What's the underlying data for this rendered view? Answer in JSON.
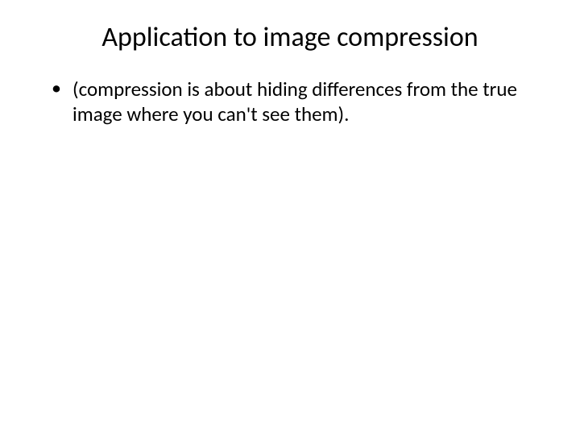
{
  "slide": {
    "title": "Application to image compression",
    "bullets": [
      "(compression is about hiding differences from the true image where you can't see them)."
    ]
  }
}
